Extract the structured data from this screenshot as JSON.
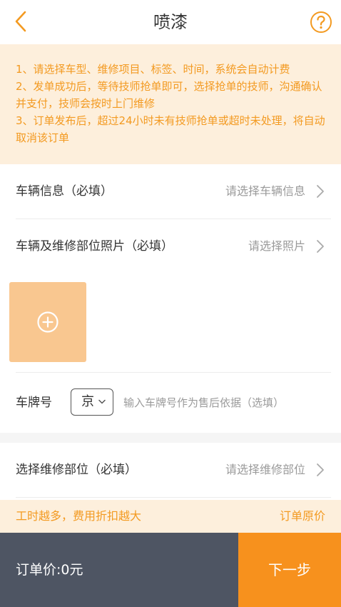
{
  "header": {
    "title": "喷漆"
  },
  "notice": {
    "lines": [
      "1、请选择车型、维修项目、标签、时间，系统会自动计费",
      "2、发单成功后，等待技师抢单即可，选择抢单的技师，沟通确认并支付，技师会按时上门维修",
      "3、订单发布后，超过24小时未有技师抢单或超时未处理，将自动取消该订单"
    ]
  },
  "form": {
    "vehicle_info": {
      "label": "车辆信息（必填）",
      "value": "请选择车辆信息"
    },
    "photos": {
      "label": "车辆及维修部位照片（必填）",
      "value": "请选择照片"
    },
    "plate": {
      "label": "车牌号",
      "province": "京",
      "placeholder": "输入车牌号作为售后依据（选填）",
      "value": ""
    },
    "repair_part": {
      "label": "选择维修部位（必填）",
      "value": "请选择维修部位"
    }
  },
  "discount_bar": {
    "left": "工时越多，费用折扣越大",
    "right": "订单原价"
  },
  "footer": {
    "total": "订单价:0元",
    "next": "下一步"
  },
  "colors": {
    "accent": "#f7911d",
    "notice_bg": "#fdefdc",
    "notice_text": "#f39a21",
    "footer_dark": "#4e5563",
    "photo_tile": "#f9c790"
  }
}
